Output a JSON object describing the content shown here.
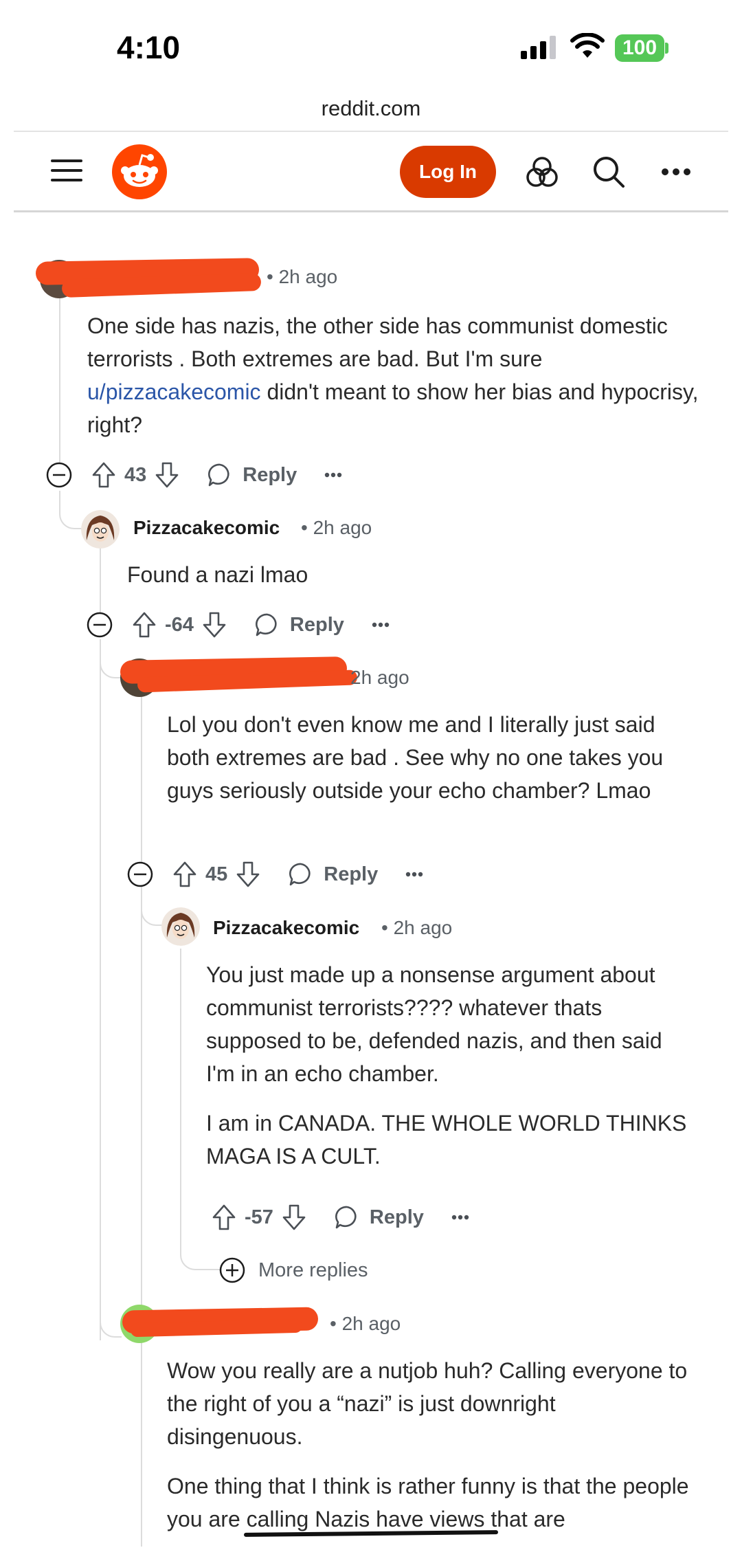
{
  "status_bar": {
    "time": "4:10",
    "battery": "100"
  },
  "browser": {
    "url": "reddit.com"
  },
  "header": {
    "login_label": "Log In"
  },
  "comments": [
    {
      "author": "",
      "time": "2h ago",
      "text_before_link": "One side has nazis, the other side has communist domestic terrorists . Both extremes are bad. But I'm sure ",
      "link": "u/pizzacakecomic",
      "text_after_link": " didn't meant to show her bias and hypocrisy, right?",
      "score": "43",
      "reply_label": "Reply"
    },
    {
      "author": "Pizzacakecomic",
      "time": "2h ago",
      "text": "Found a nazi lmao",
      "score": "-64",
      "reply_label": "Reply"
    },
    {
      "author": "",
      "time": "2h ago",
      "text": "Lol you don't even know me and I literally just said both extremes are bad . See why no one takes you guys seriously outside your echo chamber? Lmao",
      "score": "45",
      "reply_label": "Reply"
    },
    {
      "author": "Pizzacakecomic",
      "time": "2h ago",
      "paragraph_1": "You just made up a nonsense argument about communist terrorists???? whatever thats supposed to be, defended nazis, and then said I'm in an echo chamber.",
      "paragraph_2": "I am in CANADA. THE WHOLE WORLD THINKS MAGA IS A CULT.",
      "score": "-57",
      "reply_label": "Reply"
    },
    {
      "author": "",
      "time": "2h ago",
      "paragraph_1": "Wow you really are a nutjob huh? Calling everyone to the right of you a “nazi” is just downright disingenuous.",
      "paragraph_2": "One thing that I think is rather funny is that the people you are calling Nazis have views that are"
    }
  ],
  "more_replies_label": "More replies",
  "colors": {
    "reddit_orange": "#ff4500",
    "login_button": "#d93a00",
    "link": "#2b56a8",
    "battery": "#55c757",
    "redaction": "#f24a1d"
  }
}
